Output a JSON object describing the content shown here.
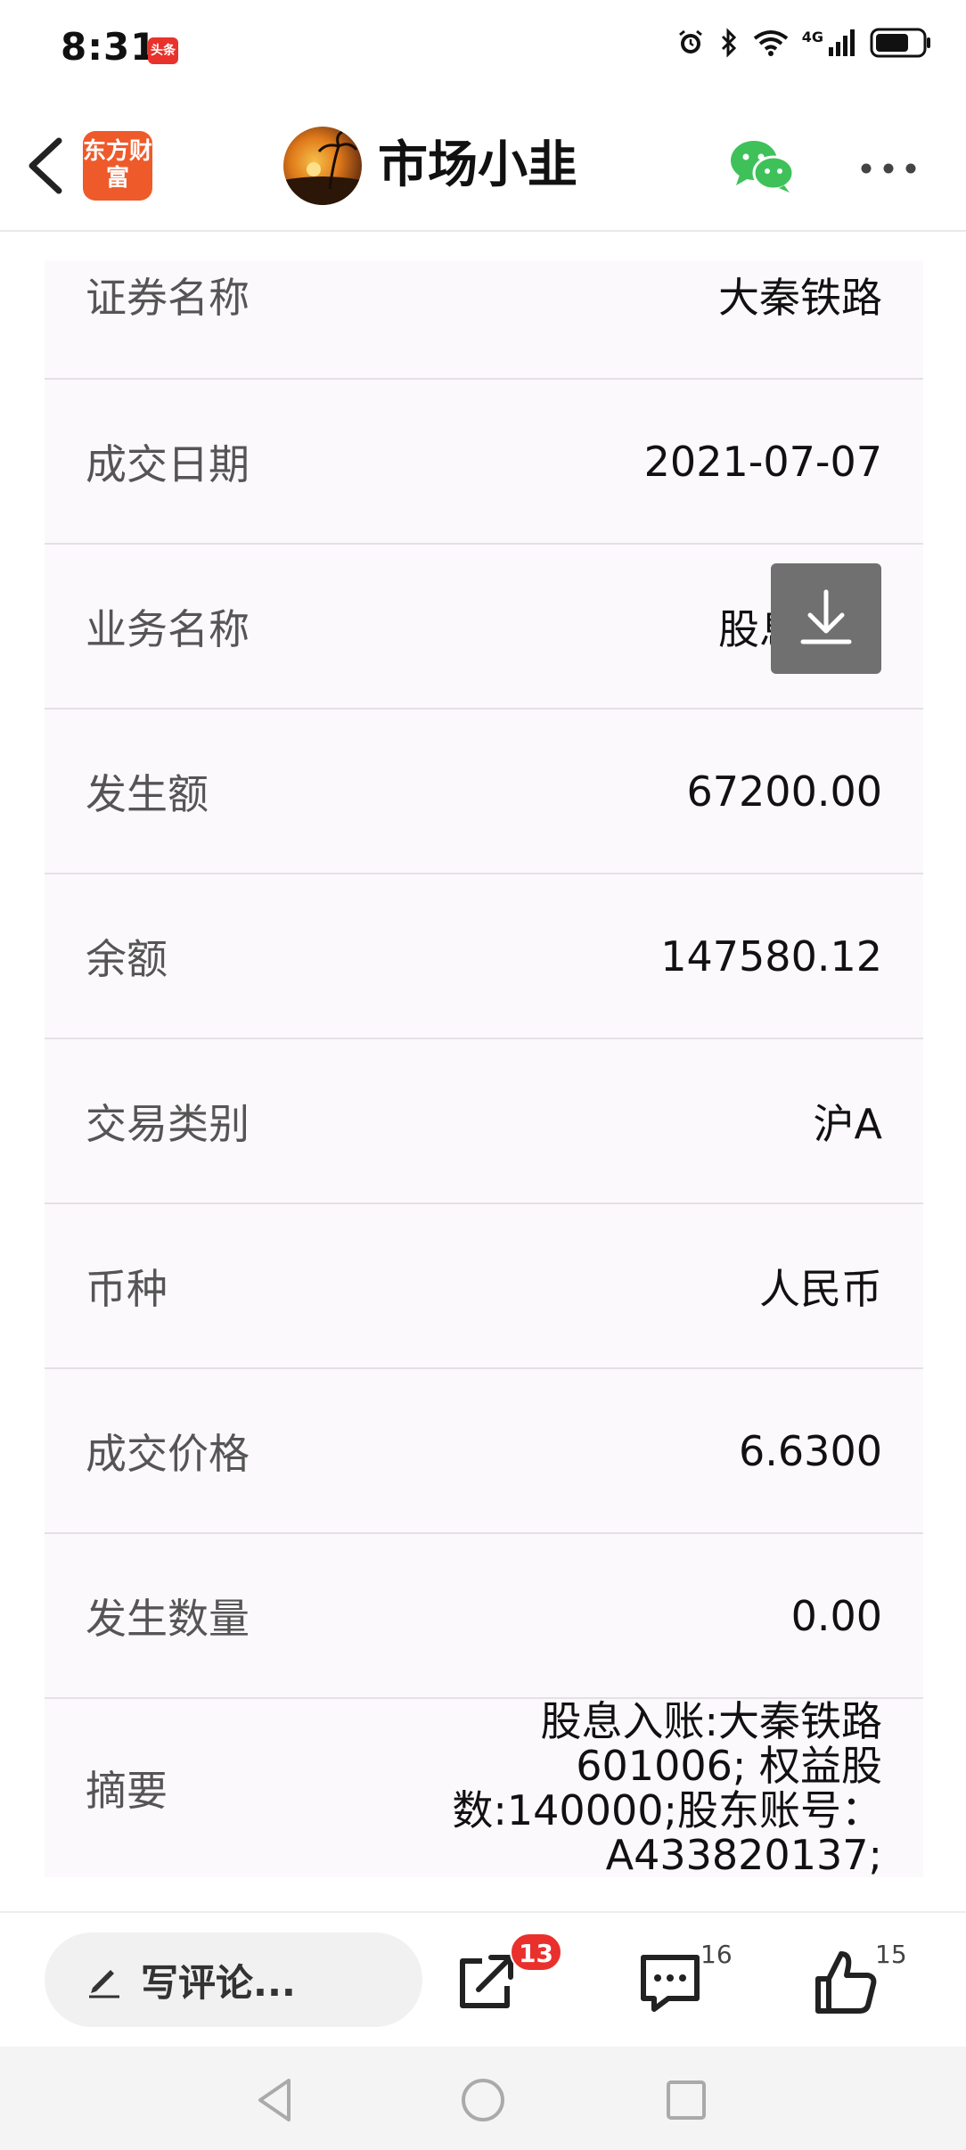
{
  "status_bar": {
    "time": "8:31",
    "app_badge": "头条",
    "network": "4G",
    "battery_percent": 70
  },
  "nav": {
    "app_logo_text": "东方财富",
    "title": "市场小韭"
  },
  "rows": [
    {
      "label": "证券名称",
      "value": "大秦铁路"
    },
    {
      "label": "成交日期",
      "value": "2021-07-07"
    },
    {
      "label": "业务名称",
      "value": "股息入账"
    },
    {
      "label": "发生额",
      "value": "67200.00"
    },
    {
      "label": "余额",
      "value": "147580.12"
    },
    {
      "label": "交易类别",
      "value": "沪A"
    },
    {
      "label": "币种",
      "value": "人民币"
    },
    {
      "label": "成交价格",
      "value": "6.6300"
    },
    {
      "label": "发生数量",
      "value": "0.00"
    },
    {
      "label": "摘要",
      "value": "股息入账:大秦铁路601006; 权益股数:140000;股东账号：A433820137;"
    }
  ],
  "toolbar": {
    "comment_placeholder": "写评论...",
    "share_badge": "13",
    "comment_count": "16",
    "like_count": "15"
  },
  "colors": {
    "accent_red": "#e9302c",
    "row_bg": "#fcf9fc",
    "download_bg": "#707070"
  },
  "icons": [
    "back-icon",
    "wechat-icon",
    "more-icon",
    "download-icon",
    "pencil-icon",
    "share-icon",
    "comment-icon",
    "like-icon"
  ]
}
